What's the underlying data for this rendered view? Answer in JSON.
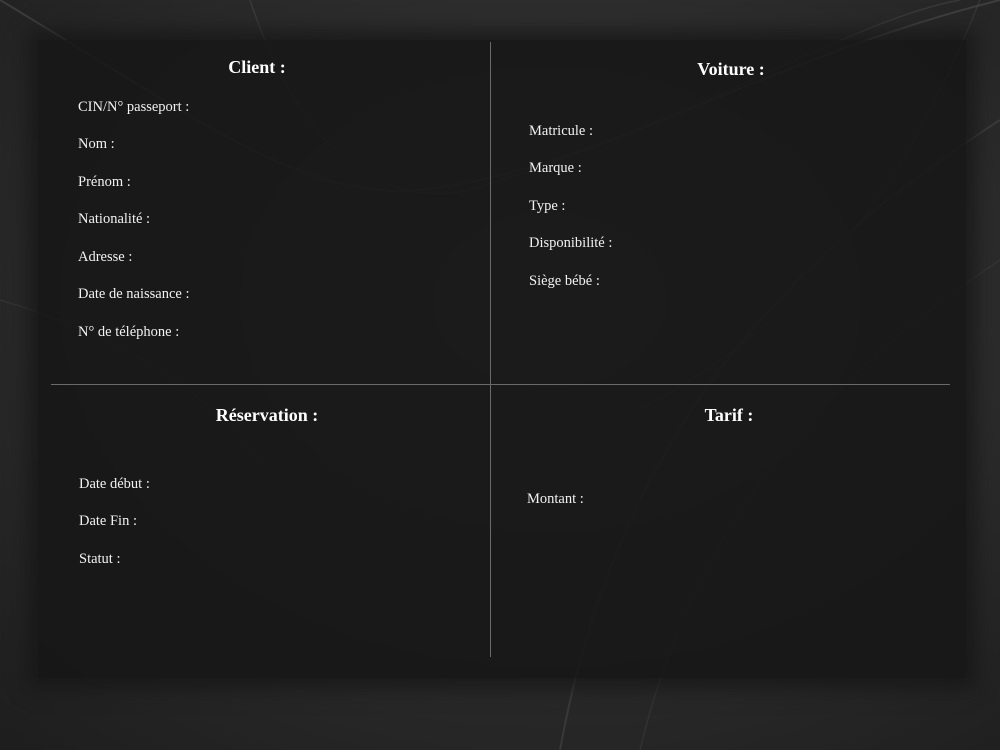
{
  "client": {
    "title": "Client :",
    "fields": [
      "CIN/N° passeport :",
      "Nom :",
      "Prénom :",
      "Nationalité :",
      "Adresse :",
      "Date de naissance :",
      "N° de téléphone :"
    ]
  },
  "voiture": {
    "title": "Voiture :",
    "fields": [
      "Matricule :",
      "Marque :",
      "Type :",
      "Disponibilité :",
      "Siège bébé :"
    ]
  },
  "reservation": {
    "title": "Réservation :",
    "fields": [
      "Date début :",
      "Date Fin :",
      "Statut :"
    ]
  },
  "tarif": {
    "title": "Tarif :",
    "fields": [
      "Montant :"
    ]
  }
}
